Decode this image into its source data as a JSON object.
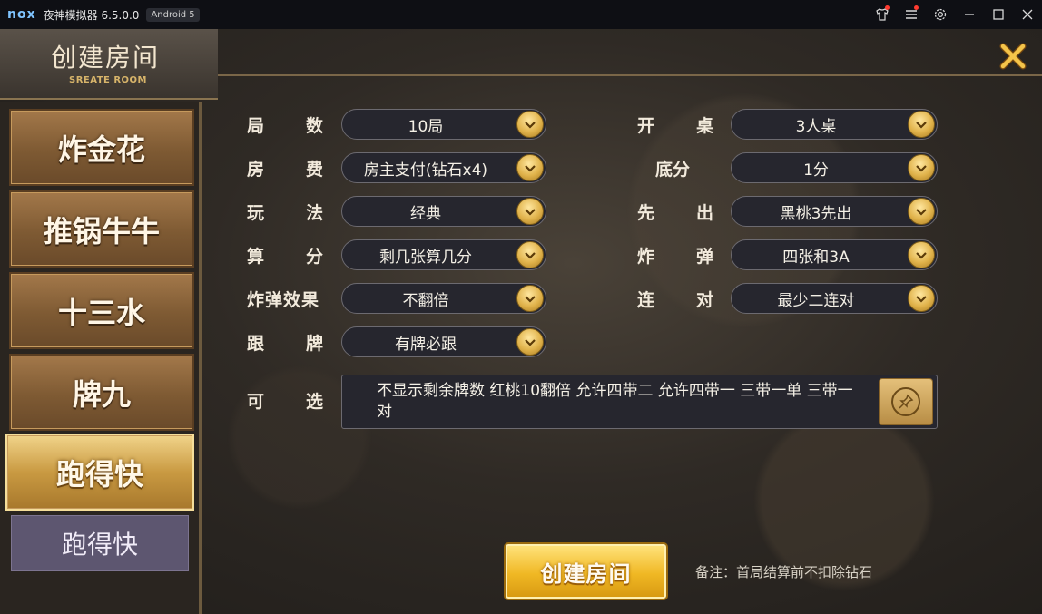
{
  "titlebar": {
    "logo": "nox",
    "app_title": "夜神模拟器 6.5.0.0",
    "android_badge": "Android 5"
  },
  "header": {
    "title": "创建房间",
    "subtitle": "SREATE ROOM"
  },
  "sidebar": {
    "tabs": [
      {
        "label": "炸金花"
      },
      {
        "label": "推锅牛牛"
      },
      {
        "label": "十三水"
      },
      {
        "label": "牌九"
      },
      {
        "label": "跑得快"
      }
    ],
    "sub_tab": "跑得快",
    "active_index": 4
  },
  "form": {
    "left": [
      {
        "label_a": "局",
        "label_b": "数",
        "value": "10局"
      },
      {
        "label_a": "房",
        "label_b": "费",
        "value": "房主支付(钻石x4)"
      },
      {
        "label_a": "玩",
        "label_b": "法",
        "value": "经典"
      },
      {
        "label_a": "算",
        "label_b": "分",
        "value": "剩几张算几分"
      },
      {
        "label": "炸弹效果",
        "value": "不翻倍"
      },
      {
        "label_a": "跟",
        "label_b": "牌",
        "value": "有牌必跟"
      }
    ],
    "right": [
      {
        "label_a": "开",
        "label_b": "桌",
        "value": "3人桌"
      },
      {
        "label": "底分",
        "value": "1分"
      },
      {
        "label_a": "先",
        "label_b": "出",
        "value": "黑桃3先出"
      },
      {
        "label_a": "炸",
        "label_b": "弹",
        "value": "四张和3A"
      },
      {
        "label_a": "连",
        "label_b": "对",
        "value": "最少二连对"
      }
    ],
    "optional": {
      "label_a": "可",
      "label_b": "选",
      "text": "不显示剩余牌数 红桃10翻倍 允许四带二 允许四带一 三带一单 三带一对"
    }
  },
  "actions": {
    "create_label": "创建房间",
    "note": "备注：首局结算前不扣除钻石"
  },
  "colors": {
    "gold_accent": "#e0b24a",
    "title_bar": "#0e0f14",
    "sub_tab": "#5d5670"
  }
}
